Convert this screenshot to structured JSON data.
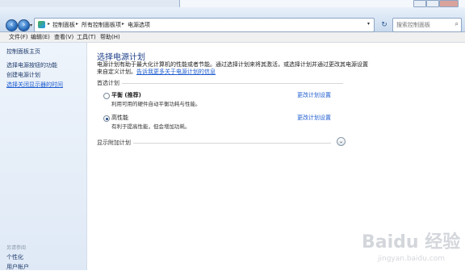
{
  "window": {
    "title_right": "搜索控制面板"
  },
  "address": {
    "crumbs": [
      "控制面板",
      "所有控制面板项",
      "电源选项"
    ],
    "search_placeholder": "搜索控制面板"
  },
  "menu": {
    "items": [
      "文件(F)",
      "编辑(E)",
      "查看(V)",
      "工具(T)",
      "帮助(H)"
    ]
  },
  "sidebar": {
    "home": "控制面板主页",
    "links": [
      "选择电源按钮的功能",
      "创建电源计划",
      "选择关闭显示器的时间"
    ],
    "see_also_label": "另请参阅",
    "see_also": [
      "个性化",
      "用户帐户"
    ]
  },
  "main": {
    "title": "选择电源计划",
    "desc_line1": "电源计划有助于最大化计算机的性能或者节能。通过选择计划来将其激活，或选择计划并通过更改其电源设置",
    "desc_line2_prefix": "来自定义计划。",
    "desc_link": "告诉我更多关于电源计划的信息",
    "group_label": "首选计划",
    "plans": [
      {
        "name": "平衡 (推荐)",
        "desc": "利用可用的硬件自动平衡功耗与性能。",
        "link": "更改计划设置",
        "selected": false
      },
      {
        "name": "高性能",
        "desc": "有利于提高性能，但会增加功耗。",
        "link": "更改计划设置",
        "selected": true
      }
    ],
    "more_plans": "显示附加计划"
  },
  "watermark": {
    "text": "Baidu 经验",
    "sub": "jingyan.baidu.com"
  }
}
